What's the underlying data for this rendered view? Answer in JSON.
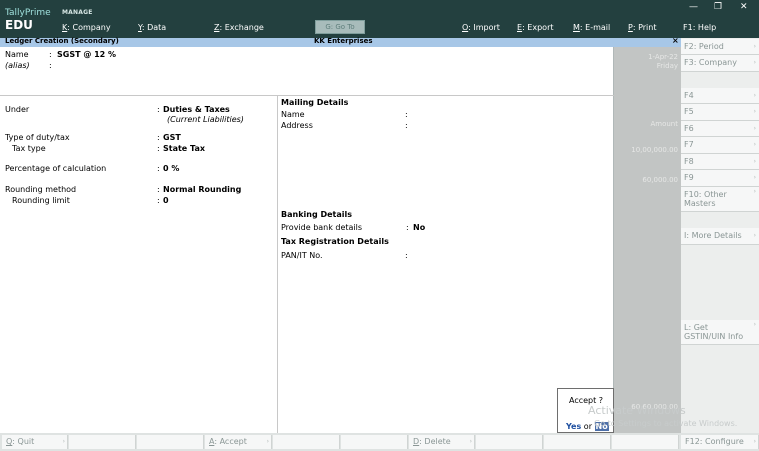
{
  "brand": {
    "line1": "TallyPrime",
    "line2": "EDU"
  },
  "top": {
    "manage": "MANAGE",
    "company_key": "K",
    "company": ": Company",
    "data_key": "Y",
    "data": ": Data",
    "exchange_key": "Z",
    "exchange": ": Exchange",
    "goto": "G: Go To",
    "import_key": "O",
    "import": ": Import",
    "export_key": "E",
    "export": ": Export",
    "email_key": "M",
    "email": ": E-mail",
    "print_key": "P",
    "print": ": Print",
    "help": "F1: Help"
  },
  "titlebar": {
    "left": "Ledger Creation (Secondary)",
    "center": "KK Enterprises",
    "close": "×"
  },
  "form": {
    "name_label": "Name",
    "name_value": "SGST @ 12 %",
    "alias_label": "(alias)",
    "under_label": "Under",
    "under_value": "Duties & Taxes",
    "under_sub": "(Current Liabilities)",
    "duty_label": "Type of duty/tax",
    "duty_value": "GST",
    "taxtype_label": "Tax type",
    "taxtype_value": "State Tax",
    "pct_label": "Percentage of calculation",
    "pct_value": "0 %",
    "round_label": "Rounding method",
    "round_value": "Normal Rounding",
    "limit_label": "Rounding limit",
    "limit_value": "0",
    "mailing_header": "Mailing Details",
    "mail_name_label": "Name",
    "mail_address_label": "Address",
    "banking_header": "Banking Details",
    "bank_label": "Provide bank details",
    "bank_value": "No",
    "taxreg_header": "Tax Registration Details",
    "pan_label": "PAN/IT No.",
    "colon": ":"
  },
  "shade": {
    "date": "1-Apr-22",
    "day": "Friday",
    "amount_label": "Amount",
    "amt1": "10,00,000.00",
    "amt2": "60,000.00",
    "amt3": "60,60,000.00"
  },
  "right_panel": [
    {
      "label": "F2: Period"
    },
    {
      "label": "F3: Company"
    },
    {
      "label": "F4"
    },
    {
      "label": "F5"
    },
    {
      "label": "F6"
    },
    {
      "label": "F7"
    },
    {
      "label": "F8"
    },
    {
      "label": "F9"
    },
    {
      "label": "F10: Other Masters"
    },
    {
      "label": "I: More Details"
    },
    {
      "label": "L: Get GSTIN/UIN Info"
    }
  ],
  "accept": {
    "question": "Accept ?",
    "yes": "Yes",
    "or": "or",
    "no": "No"
  },
  "watermark": {
    "line1": "Activate Windows",
    "line2": "Go to Settings to activate Windows."
  },
  "bottom": {
    "quit_key": "Q",
    "quit": ": Quit",
    "accept_key": "A",
    "accept": ": Accept",
    "delete_key": "D",
    "delete": ": Delete",
    "configure": "F12: Configure"
  },
  "window": {
    "minimize": "—",
    "restore": "❐",
    "close": "✕"
  }
}
